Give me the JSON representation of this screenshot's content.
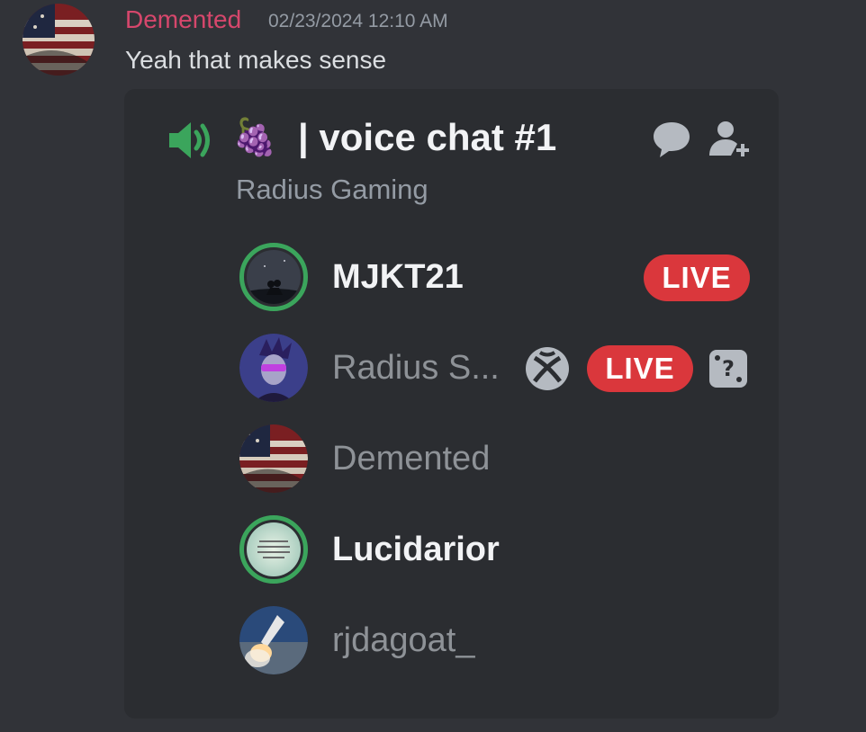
{
  "message": {
    "author": "Demented",
    "timestamp": "02/23/2024 12:10 AM",
    "text": "Yeah that makes sense"
  },
  "voice_card": {
    "channel_emoji": "🍇",
    "channel_name": "| voice chat #1",
    "server_name": "Radius Gaming",
    "icons": [
      "speaker-icon",
      "chat-bubble-icon",
      "add-user-icon"
    ],
    "members": [
      {
        "name": "MJKT21",
        "speaking": true,
        "live_label": "LIVE"
      },
      {
        "name": "Radius S...",
        "speaking": false,
        "platform_icon": "xbox-icon",
        "live_label": "LIVE",
        "activity_icon": "dice-icon"
      },
      {
        "name": "Demented",
        "speaking": false
      },
      {
        "name": "Lucidarior",
        "speaking": true,
        "avatar_text": "feeling cute, might smash the prophet hmmm later idk"
      },
      {
        "name": "rjdagoat_",
        "speaking": false
      }
    ]
  },
  "colors": {
    "background": "#313338",
    "card": "#2b2d31",
    "author": "#d6476c",
    "speaking_ring": "#3ba55c",
    "live": "#da373c"
  }
}
